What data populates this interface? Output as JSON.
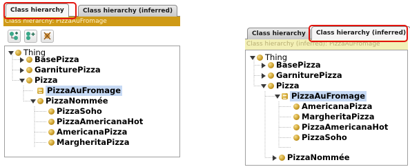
{
  "colors": {
    "tab_highlight": "#e3140e",
    "title_bar": "#cf9a16",
    "title_bar_pale": "#f3f0b6",
    "selection": "#c6d9f4",
    "class_bullet": "#c89a24"
  },
  "left_panel": {
    "tabs": [
      {
        "label": "Class hierarchy",
        "active": true
      },
      {
        "label": "Class hierarchy (inferred)",
        "active": false
      }
    ],
    "title": "Class hierarchy: PizzaAuFromage",
    "toolbar": [
      {
        "icon": "add-subclass-icon"
      },
      {
        "icon": "add-sibling-class-icon"
      },
      {
        "icon": "delete-class-icon"
      }
    ],
    "tree": [
      {
        "label": "Thing",
        "toggle": "expanded",
        "bullet": "class"
      },
      {
        "label": "BasePizza",
        "toggle": "collapsed",
        "bullet": "class"
      },
      {
        "label": "GarniturePizza",
        "toggle": "collapsed",
        "bullet": "class"
      },
      {
        "label": "Pizza",
        "toggle": "expanded",
        "bullet": "class"
      },
      {
        "label": "PizzaAuFromage",
        "toggle": "none",
        "bullet": "defined-class",
        "selected": true
      },
      {
        "label": "PizzaNommée",
        "toggle": "expanded",
        "bullet": "class"
      },
      {
        "label": "PizzaSoho",
        "toggle": "none",
        "bullet": "class"
      },
      {
        "label": "PizzaAmericanaHot",
        "toggle": "none",
        "bullet": "class"
      },
      {
        "label": "AmericanaPizza",
        "toggle": "none",
        "bullet": "class"
      },
      {
        "label": "MargheritaPizza",
        "toggle": "none",
        "bullet": "class"
      }
    ]
  },
  "right_panel": {
    "tabs": [
      {
        "label": "Class hierarchy",
        "active": false
      },
      {
        "label": "Class hierarchy (inferred)",
        "active": true
      }
    ],
    "title": "Class hierarchy (inferred): PizzaAuFromage",
    "tree": [
      {
        "label": "Thing",
        "toggle": "expanded",
        "bullet": "class"
      },
      {
        "label": "BasePizza",
        "toggle": "collapsed",
        "bullet": "class"
      },
      {
        "label": "GarniturePizza",
        "toggle": "collapsed",
        "bullet": "class"
      },
      {
        "label": "Pizza",
        "toggle": "expanded",
        "bullet": "class"
      },
      {
        "label": "PizzaAuFromage",
        "toggle": "expanded",
        "bullet": "defined-class",
        "selected": true
      },
      {
        "label": "AmericanaPizza",
        "toggle": "none",
        "bullet": "class"
      },
      {
        "label": "MargheritaPizza",
        "toggle": "none",
        "bullet": "class"
      },
      {
        "label": "PizzaAmericanaHot",
        "toggle": "none",
        "bullet": "class"
      },
      {
        "label": "PizzaSoho",
        "toggle": "none",
        "bullet": "class"
      },
      {
        "label": "PizzaNommée",
        "toggle": "collapsed",
        "bullet": "class"
      }
    ]
  }
}
